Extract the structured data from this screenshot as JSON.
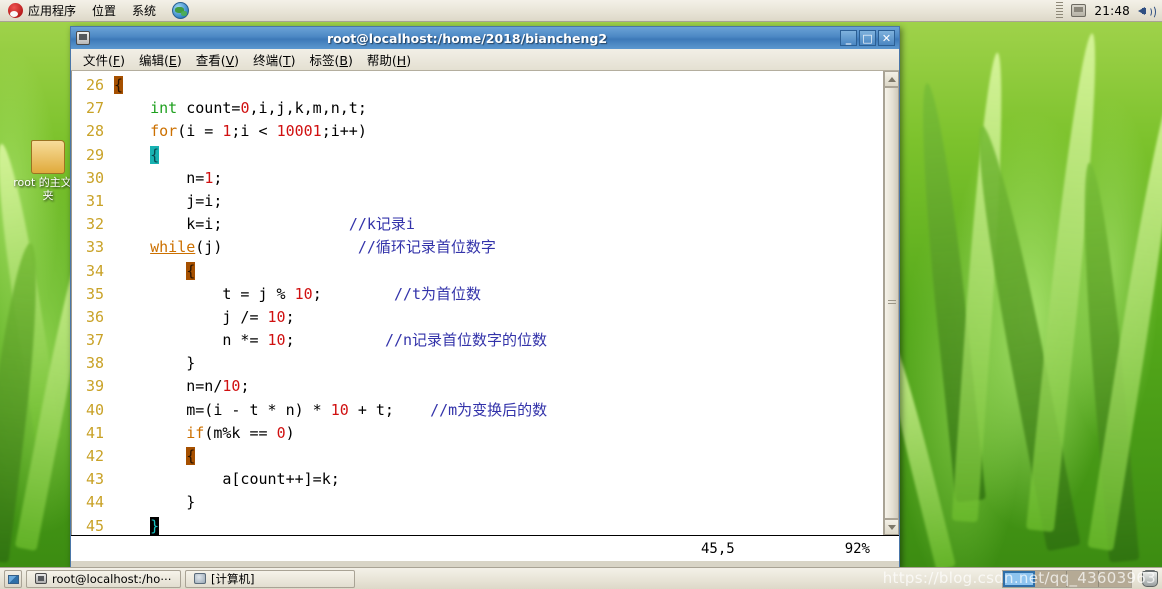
{
  "top_panel": {
    "applications_label": "应用程序",
    "places_label": "位置",
    "system_label": "系统",
    "browser_icon": "globe-icon",
    "clock": "21:48",
    "tray_icons": [
      "display-icon",
      "volume-icon"
    ]
  },
  "desktop_icons": [
    {
      "label": "root 的主文件夹",
      "icon": "folder-icon"
    }
  ],
  "window": {
    "title": "root@localhost:/home/2018/biancheng2",
    "icon": "terminal-icon",
    "controls": {
      "minimize": "_",
      "maximize": "□",
      "close": "✕"
    },
    "menus": [
      {
        "label": "文件",
        "accel": "F"
      },
      {
        "label": "编辑",
        "accel": "E"
      },
      {
        "label": "查看",
        "accel": "V"
      },
      {
        "label": "终端",
        "accel": "T"
      },
      {
        "label": "标签",
        "accel": "B"
      },
      {
        "label": "帮助",
        "accel": "H"
      }
    ],
    "status": {
      "position": "45,5",
      "zoom": "92%"
    },
    "scrollbar": {
      "up_arrow": "chevron-up-icon",
      "down_arrow": "chevron-down-icon"
    }
  },
  "editor": {
    "lines": [
      {
        "num": "26",
        "segments": [
          {
            "t": "",
            "c": "plain"
          },
          {
            "t": "{",
            "c": "br-brown"
          }
        ]
      },
      {
        "num": "27",
        "segments": [
          {
            "t": "    ",
            "c": "plain"
          },
          {
            "t": "int",
            "c": "kw-type"
          },
          {
            "t": " count=",
            "c": "plain"
          },
          {
            "t": "0",
            "c": "num"
          },
          {
            "t": ",i,j,k,m,n,t;",
            "c": "plain"
          }
        ]
      },
      {
        "num": "28",
        "segments": [
          {
            "t": "    ",
            "c": "plain"
          },
          {
            "t": "for",
            "c": "kw-ctrl"
          },
          {
            "t": "(i = ",
            "c": "plain"
          },
          {
            "t": "1",
            "c": "num"
          },
          {
            "t": ";i < ",
            "c": "plain"
          },
          {
            "t": "10001",
            "c": "num"
          },
          {
            "t": ";i++)",
            "c": "plain"
          }
        ]
      },
      {
        "num": "29",
        "segments": [
          {
            "t": "    ",
            "c": "plain"
          },
          {
            "t": "{",
            "c": "br-teal"
          }
        ]
      },
      {
        "num": "30",
        "segments": [
          {
            "t": "        n=",
            "c": "plain"
          },
          {
            "t": "1",
            "c": "num"
          },
          {
            "t": ";",
            "c": "plain"
          }
        ]
      },
      {
        "num": "31",
        "segments": [
          {
            "t": "        j=i;",
            "c": "plain"
          }
        ]
      },
      {
        "num": "32",
        "segments": [
          {
            "t": "        k=i;",
            "c": "plain"
          },
          {
            "t": "              ",
            "c": "plain"
          },
          {
            "t": "//k记录i",
            "c": "cmt"
          }
        ]
      },
      {
        "num": "33",
        "segments": [
          {
            "t": "    ",
            "c": "plain"
          },
          {
            "t": "while",
            "c": "kw-ctrl squig"
          },
          {
            "t": "(j)",
            "c": "plain"
          },
          {
            "t": "               ",
            "c": "plain"
          },
          {
            "t": "//循环记录首位数字",
            "c": "cmt"
          }
        ]
      },
      {
        "num": "34",
        "segments": [
          {
            "t": "        ",
            "c": "plain"
          },
          {
            "t": "{",
            "c": "br-brown"
          }
        ]
      },
      {
        "num": "35",
        "segments": [
          {
            "t": "            t = j % ",
            "c": "plain"
          },
          {
            "t": "10",
            "c": "num"
          },
          {
            "t": ";",
            "c": "plain"
          },
          {
            "t": "        ",
            "c": "plain"
          },
          {
            "t": "//t为首位数",
            "c": "cmt"
          }
        ]
      },
      {
        "num": "36",
        "segments": [
          {
            "t": "            j /= ",
            "c": "plain"
          },
          {
            "t": "10",
            "c": "num"
          },
          {
            "t": ";",
            "c": "plain"
          }
        ]
      },
      {
        "num": "37",
        "segments": [
          {
            "t": "            n *= ",
            "c": "plain"
          },
          {
            "t": "10",
            "c": "num"
          },
          {
            "t": ";",
            "c": "plain"
          },
          {
            "t": "          ",
            "c": "plain"
          },
          {
            "t": "//n记录首位数字的位数",
            "c": "cmt"
          }
        ]
      },
      {
        "num": "38",
        "segments": [
          {
            "t": "        }",
            "c": "plain"
          }
        ]
      },
      {
        "num": "39",
        "segments": [
          {
            "t": "        n=n/",
            "c": "plain"
          },
          {
            "t": "10",
            "c": "num"
          },
          {
            "t": ";",
            "c": "plain"
          }
        ]
      },
      {
        "num": "40",
        "segments": [
          {
            "t": "        m=(i - t * n) * ",
            "c": "plain"
          },
          {
            "t": "10",
            "c": "num"
          },
          {
            "t": " + t;",
            "c": "plain"
          },
          {
            "t": "    ",
            "c": "plain"
          },
          {
            "t": "//m为变换后的数",
            "c": "cmt"
          }
        ]
      },
      {
        "num": "41",
        "segments": [
          {
            "t": "        ",
            "c": "plain"
          },
          {
            "t": "if",
            "c": "kw-ctrl"
          },
          {
            "t": "(m%k == ",
            "c": "plain"
          },
          {
            "t": "0",
            "c": "num"
          },
          {
            "t": ")",
            "c": "plain"
          }
        ]
      },
      {
        "num": "42",
        "segments": [
          {
            "t": "        ",
            "c": "plain"
          },
          {
            "t": "{",
            "c": "br-brown"
          }
        ]
      },
      {
        "num": "43",
        "segments": [
          {
            "t": "            a[count++]=k;",
            "c": "plain"
          }
        ]
      },
      {
        "num": "44",
        "segments": [
          {
            "t": "        }",
            "c": "plain"
          }
        ]
      },
      {
        "num": "45",
        "segments": [
          {
            "t": "    ",
            "c": "plain"
          },
          {
            "t": "}",
            "c": "br-cursor"
          }
        ]
      }
    ]
  },
  "bottom_panel": {
    "show_desktop_icon": "show-desktop-icon",
    "tasks": [
      {
        "label": "root@localhost:/ho⋯",
        "icon": "terminal-icon"
      },
      {
        "label": "[计算机]",
        "icon": "computer-icon"
      }
    ],
    "workspaces": [
      {
        "name": "workspace-1",
        "active": true
      },
      {
        "name": "workspace-2",
        "active": false
      },
      {
        "name": "workspace-3",
        "active": false
      },
      {
        "name": "workspace-4",
        "active": false
      }
    ],
    "trash_icon": "trash-icon"
  },
  "watermark": "https://blog.csdn.net/qq_43603963"
}
